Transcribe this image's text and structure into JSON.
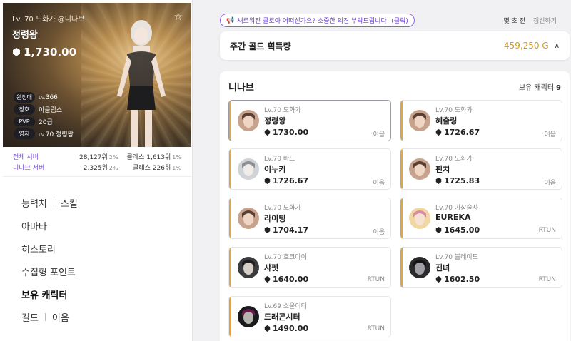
{
  "profile": {
    "server_line": "Lv. 70 도화가 @니나브",
    "name": "정령왕",
    "item_level": "1,730.00",
    "stats": [
      {
        "tag": "원정대",
        "prefix": "Lv.",
        "value": "366"
      },
      {
        "tag": "칭호",
        "prefix": "",
        "value": "이클립스"
      },
      {
        "tag": "PVP",
        "prefix": "",
        "value": "20급"
      },
      {
        "tag": "영지",
        "prefix": "Lv.",
        "value": "70 정령왕"
      }
    ],
    "ranks": [
      {
        "label": "전체 서버",
        "rank": "28,127위",
        "rank_pct": "2%",
        "class_rank": "클래스 1,613위",
        "class_pct": "1%"
      },
      {
        "label": "니나브 서버",
        "rank": "2,325위",
        "rank_pct": "2%",
        "class_rank": "클래스 226위",
        "class_pct": "1%"
      }
    ]
  },
  "menu": {
    "ability": "능력치",
    "skill": "스킬",
    "avatar": "아바타",
    "history": "히스토리",
    "collectibles": "수집형 포인트",
    "roster": "보유 캐릭터",
    "guild": "길드",
    "guild_name": "이음"
  },
  "header": {
    "notice": "새로워진 클로아 어떠신가요? 소중한 의견 부탁드립니다! (클릭)",
    "ago": "몇 초 전",
    "refresh": "갱신하기"
  },
  "gold": {
    "title": "주간 골드 획득량",
    "value": "459,250 G"
  },
  "roster": {
    "server": "니나브",
    "count_label": "보유 캐릭터",
    "count": "9",
    "characters": [
      {
        "cls": "Lv.70 도화가",
        "name": "정령왕",
        "ilvl": "1730.00",
        "guild": "이음"
      },
      {
        "cls": "Lv.70 도화가",
        "name": "혜출링",
        "ilvl": "1726.67",
        "guild": "이음"
      },
      {
        "cls": "Lv.70 바드",
        "name": "이누키",
        "ilvl": "1726.67",
        "guild": "이음"
      },
      {
        "cls": "Lv.70 도화가",
        "name": "핀치",
        "ilvl": "1725.83",
        "guild": "이음"
      },
      {
        "cls": "Lv.70 도화가",
        "name": "라이팅",
        "ilvl": "1704.17",
        "guild": "이음"
      },
      {
        "cls": "Lv.70 기상술사",
        "name": "EUREKA",
        "ilvl": "1645.00",
        "guild": "RTUN"
      },
      {
        "cls": "Lv.70 호크아이",
        "name": "샤펫",
        "ilvl": "1640.00",
        "guild": "RTUN"
      },
      {
        "cls": "Lv.70 블레이드",
        "name": "진녀",
        "ilvl": "1602.50",
        "guild": "RTUN"
      },
      {
        "cls": "Lv.69 소울이터",
        "name": "드래곤시터",
        "ilvl": "1490.00",
        "guild": "RTUN"
      }
    ]
  },
  "colors": {
    "accent_purple": "#7a4fd6",
    "gold": "#d49a1e",
    "bar_gold": "#d7a94a",
    "bar_orange": "#f0a020"
  }
}
